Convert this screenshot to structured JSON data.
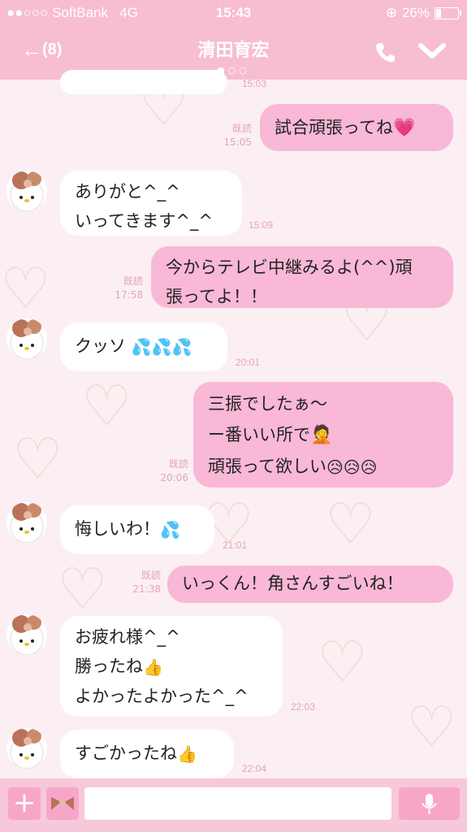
{
  "status": {
    "carrier": "●●○○○ SoftBank",
    "network": "4G",
    "time": "15:43",
    "battery": "26%",
    "battery_level": 0.26
  },
  "header": {
    "back_count": "(8)",
    "title": "清田育宏"
  },
  "messages": [
    {
      "dir": "in",
      "lines": [
        "…"
      ],
      "time": "15:03"
    },
    {
      "dir": "out",
      "lines": [
        "試合頑張ってね"
      ],
      "read": "既読",
      "time": "15:05",
      "emoji": "heart-icon"
    },
    {
      "dir": "in",
      "lines": [
        "ありがと^_^",
        "いってきます^_^"
      ],
      "time": "15:09"
    },
    {
      "dir": "out",
      "lines": [
        "今からテレビ中継みるよ(^^)頑",
        "張ってよ！！"
      ],
      "read": "既読",
      "time": "17:58"
    },
    {
      "dir": "in",
      "lines": [
        "クッソ"
      ],
      "time": "20:01",
      "emoji": "sweat-drops-icon"
    },
    {
      "dir": "out",
      "lines": [
        "三振でしたぁ〜",
        "ー番いい所で",
        "頑張って欲しい"
      ],
      "read": "既読",
      "time": "20:06"
    },
    {
      "dir": "in",
      "lines": [
        "悔しいわ！"
      ],
      "time": "21:01"
    },
    {
      "dir": "out",
      "lines": [
        "いっくん！角さんすごいね！"
      ],
      "read": "既読",
      "time": "21:38"
    },
    {
      "dir": "in",
      "lines": [
        "お疲れ様^_^",
        "勝ったね",
        "よかったよかった^_^"
      ],
      "time": "22:03"
    },
    {
      "dir": "in",
      "lines": [
        "すごかったね"
      ],
      "time": "22:04"
    }
  ],
  "icons": {
    "back": "back-arrow-icon",
    "call": "phone-icon",
    "menu": "chevron-down-icon",
    "add": "plus-icon",
    "sticker": "bow-icon",
    "mic": "mic-icon"
  },
  "colors": {
    "header": "#f7bdd3",
    "out_bubble": "#f8b8d6",
    "in_bubble": "#ffffff",
    "timestamp": "#e2a6b8"
  }
}
